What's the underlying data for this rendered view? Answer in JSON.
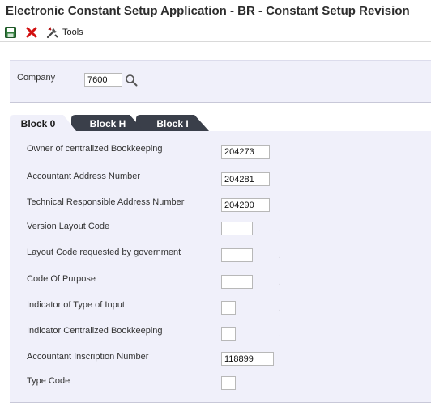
{
  "window": {
    "title": "Electronic Constant Setup Application - BR - Constant Setup Revision"
  },
  "toolbar": {
    "tools_label_underlined": "T",
    "tools_label_rest": "ools"
  },
  "company": {
    "label": "Company",
    "value": "7600"
  },
  "tabs": [
    {
      "label": "Block 0"
    },
    {
      "label": "Block H"
    },
    {
      "label": "Block I"
    }
  ],
  "fields": {
    "owner_centralized": {
      "label": "Owner of centralized Bookkeeping",
      "value": "204273"
    },
    "accountant_address": {
      "label": "Accountant Address Number",
      "value": "204281"
    },
    "technical_responsible": {
      "label": "Technical Responsible Address Number",
      "value": "204290"
    },
    "version_layout": {
      "label": "Version Layout Code",
      "value": "",
      "suffix": "."
    },
    "layout_government": {
      "label": "Layout Code requested by government",
      "value": "",
      "suffix": "."
    },
    "code_of_purpose": {
      "label": "Code Of Purpose",
      "value": "",
      "suffix": "."
    },
    "type_of_input": {
      "label": "Indicator of Type of Input",
      "value": "",
      "suffix": "."
    },
    "centralized_indicator": {
      "label": "Indicator Centralized Bookkeeping",
      "value": "",
      "suffix": "."
    },
    "inscription_number": {
      "label": "Accountant Inscription Number",
      "value": "118899"
    },
    "type_code": {
      "label": "Type Code",
      "value": ""
    }
  },
  "colors": {
    "panel_bg": "#f0f0fa",
    "tab_inactive": "#3a3f4a",
    "tab_active": "#f0f0fa",
    "cancel_red": "#d21010",
    "save_green": "#2f7a3a"
  },
  "icons": [
    "save-icon",
    "cancel-icon",
    "tools-icon",
    "search-icon"
  ]
}
